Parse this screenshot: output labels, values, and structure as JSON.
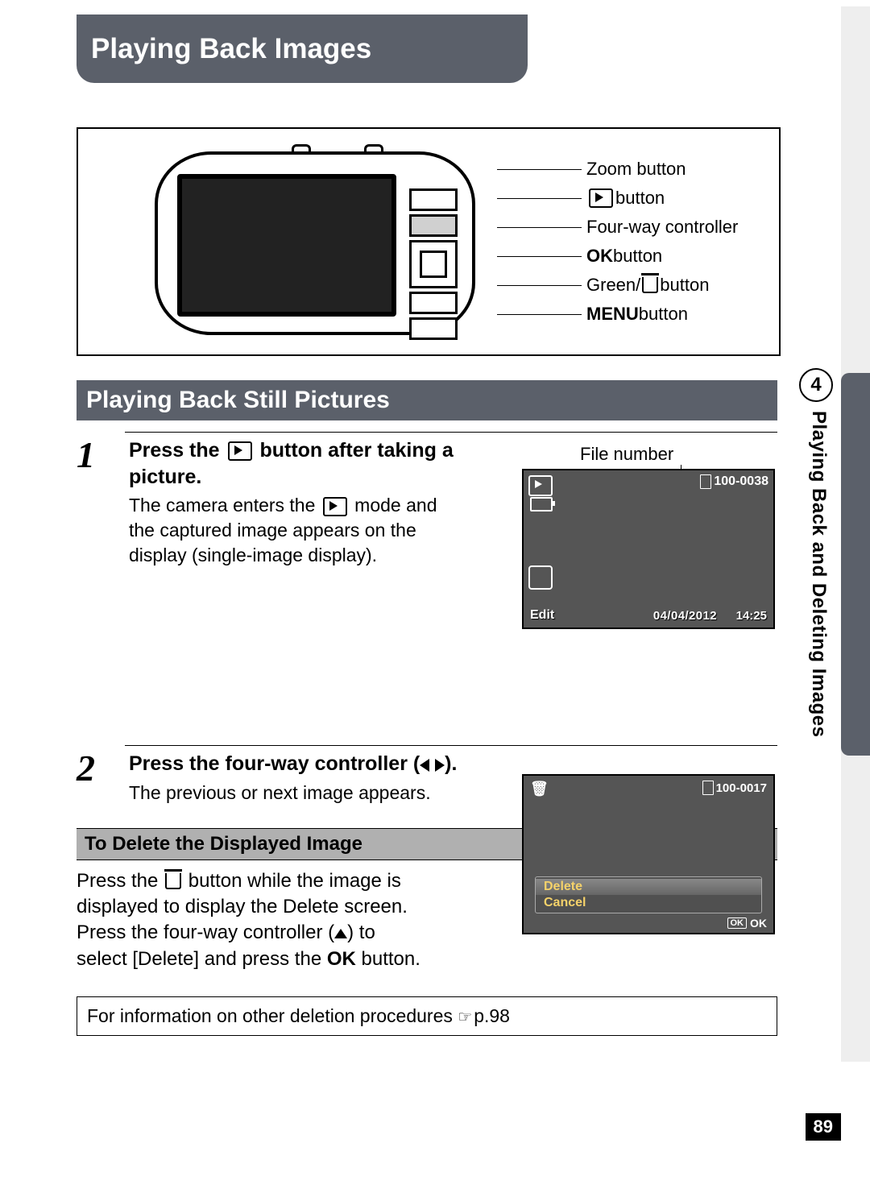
{
  "chapter": {
    "title": "Playing Back Images"
  },
  "side": {
    "chapter_number": "4",
    "label": "Playing Back and Deleting Images",
    "page_number": "89"
  },
  "diagram": {
    "labels": {
      "zoom": "Zoom button",
      "playback_button": " button",
      "fourway": "Four-way controller",
      "ok_prefix": "OK",
      "ok_suffix": " button",
      "green_prefix": "Green/",
      "green_suffix": " button",
      "menu_prefix": "MENU",
      "menu_suffix": " button"
    }
  },
  "section": {
    "title": "Playing Back Still Pictures"
  },
  "step1": {
    "heading_a": "Press the ",
    "heading_b": " button after taking a picture.",
    "body_a": "The camera enters the ",
    "body_b": " mode and the captured image appears on the display (single-image display).",
    "caption": "File number",
    "screenshot": {
      "file_no": "100-0038",
      "edit": "Edit",
      "date": "04/04/2012",
      "time": "14:25"
    }
  },
  "step2": {
    "heading_a": "Press the four-way controller (",
    "heading_b": ").",
    "body": "The previous or next image appears."
  },
  "delete": {
    "subsection_title": "To Delete the Displayed Image",
    "body_a": "Press the ",
    "body_b": " button while the image is displayed to display the Delete screen. Press the four-way controller (",
    "body_c": ") to select [Delete] and press the ",
    "ok_word": "OK",
    "body_d": " button.",
    "screenshot": {
      "file_no": "100-0017",
      "opt_delete": "Delete",
      "opt_cancel": "Cancel",
      "ok_label": "OK"
    }
  },
  "info_box": {
    "text_a": "For information on other deletion procedures ",
    "pageref": "p.98"
  }
}
